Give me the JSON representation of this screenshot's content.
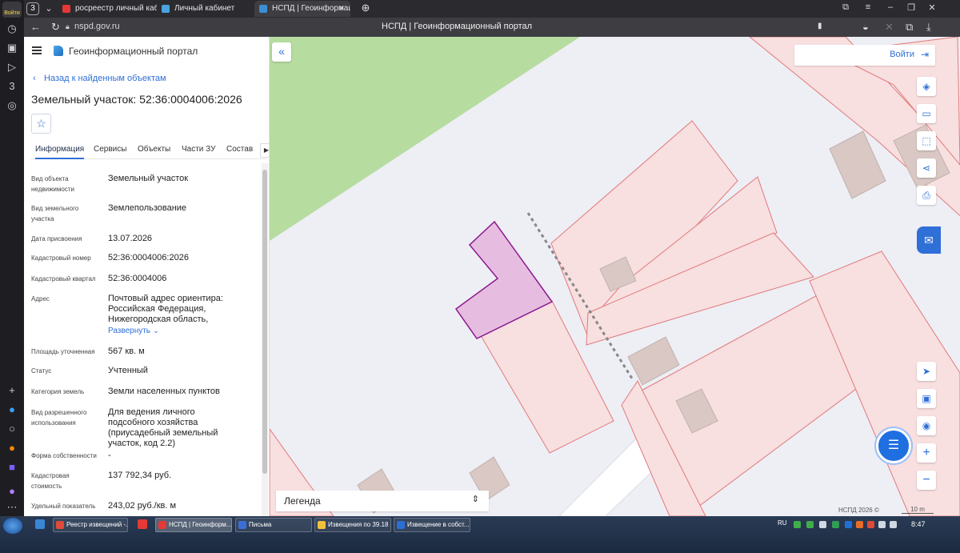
{
  "browser": {
    "tab_count": "3",
    "login_badge": "Войти",
    "tabs": [
      {
        "label": "росреестр личный кабин",
        "icon_color": "#e53935"
      },
      {
        "label": "Личный кабинет",
        "icon_color": "#4aa3df"
      },
      {
        "label": "НСПД | Геоинформац",
        "icon_color": "#3b8ed6"
      }
    ],
    "url": "nspd.gov.ru",
    "page_title": "НСПД | Геоинформационный портал"
  },
  "app": {
    "title": "Геоинформационный портал",
    "back_link": "Назад к найденным объектам",
    "object_title": "Земельный участок: 52:36:0004006:2026",
    "tabs": [
      "Информация",
      "Сервисы",
      "Объекты",
      "Части ЗУ",
      "Состав"
    ],
    "properties": [
      {
        "label": "Вид объекта недвижимости",
        "value": "Земельный участок"
      },
      {
        "label": "Вид земельного участка",
        "value": "Землепользование"
      },
      {
        "label": "Дата присвоения",
        "value": "13.07.2026"
      },
      {
        "label": "Кадастровый номер",
        "value": "52:36:0004006:2026"
      },
      {
        "label": "Кадастровый квартал",
        "value": "52:36:0004006"
      },
      {
        "label": "Адрес",
        "value": "Почтовый адрес ориентира: Российская Федерация, Нижегородская область,"
      },
      {
        "label": "Площадь уточненная",
        "value": "567 кв. м"
      },
      {
        "label": "Статус",
        "value": "Учтенный"
      },
      {
        "label": "Категория земель",
        "value": "Земли населенных пунктов"
      },
      {
        "label": "Вид разрешенного использования",
        "value": "Для ведения личного подсобного хозяйства (приусадебный земельный участок, код 2.2)"
      },
      {
        "label": "Форма собственности",
        "value": "-"
      },
      {
        "label": "Кадастровая стоимость",
        "value": "137 792,34 руб."
      },
      {
        "label": "Удельный показатель",
        "value": "243,02 руб./кв. м"
      }
    ],
    "expand_label": "Развернуть"
  },
  "map": {
    "login_label": "Войти",
    "legend_label": "Легенда",
    "copyright": "НСПД 2026 ©",
    "scale": "10 m",
    "colors": {
      "background": "#eeeef5",
      "green_area": "#b6dca0",
      "parcel_fill": "#f8dfe0",
      "parcel_stroke": "#e07a7a",
      "selected_fill": "#e6bde0",
      "selected_stroke": "#8b1a8f",
      "building": "#d9c8c3",
      "road": "#ffffff"
    }
  },
  "taskbar": {
    "items": [
      {
        "label": "Реестр извещений -...",
        "icon_color": "#e04a3a"
      },
      {
        "label": "НСПД | Геоинформ...",
        "icon_color": "#e53935"
      },
      {
        "label": "Письма",
        "icon_color": "#3b6fd6"
      },
      {
        "label": "Извещения по 39.18",
        "icon_color": "#f0c23a"
      },
      {
        "label": "Извещение в собст...",
        "icon_color": "#2b6fd6"
      }
    ],
    "lang": "RU",
    "clock": "8:47"
  }
}
